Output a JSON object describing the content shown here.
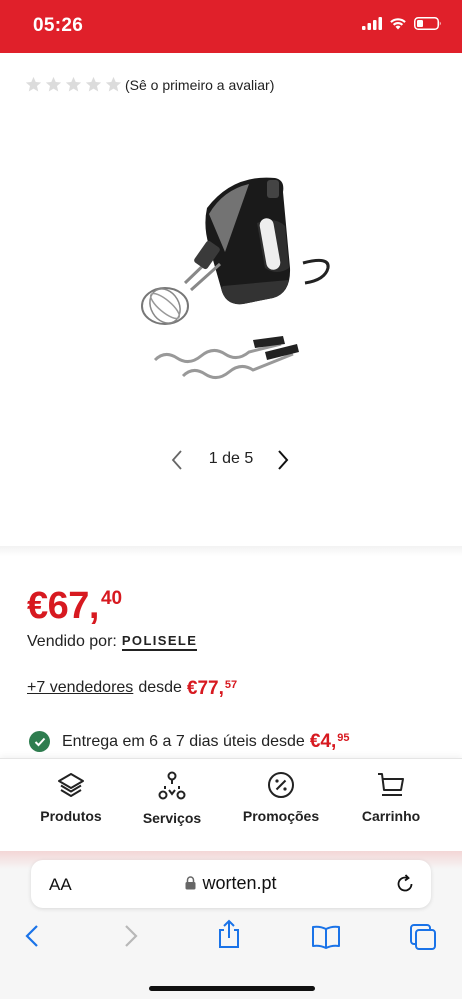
{
  "status_bar": {
    "time": "05:26"
  },
  "rating": {
    "text": "(Sê o primeiro a avaliar)",
    "stars": 5
  },
  "gallery": {
    "counter": "1 de 5"
  },
  "price": {
    "main": "€67,",
    "cents": "40"
  },
  "seller": {
    "label": "Vendido por:",
    "name": "POLISELE"
  },
  "other_sellers": {
    "link": "+7 vendedores",
    "from": "desde",
    "price_main": "€77,",
    "price_cents": "57"
  },
  "delivery": {
    "text": "Entrega em 6 a 7 dias úteis desde",
    "price_main": "€4,",
    "price_cents": "95"
  },
  "bottom_nav": [
    {
      "label": "Produtos",
      "icon": "layers-icon"
    },
    {
      "label": "Serviços",
      "icon": "services-icon"
    },
    {
      "label": "Promoções",
      "icon": "percent-icon"
    },
    {
      "label": "Carrinho",
      "icon": "cart-icon"
    }
  ],
  "browser": {
    "aa": "AA",
    "url": "worten.pt"
  },
  "colors": {
    "brand_red": "#e0202a",
    "price_red": "#d71920",
    "check_green": "#2e7d4f"
  }
}
